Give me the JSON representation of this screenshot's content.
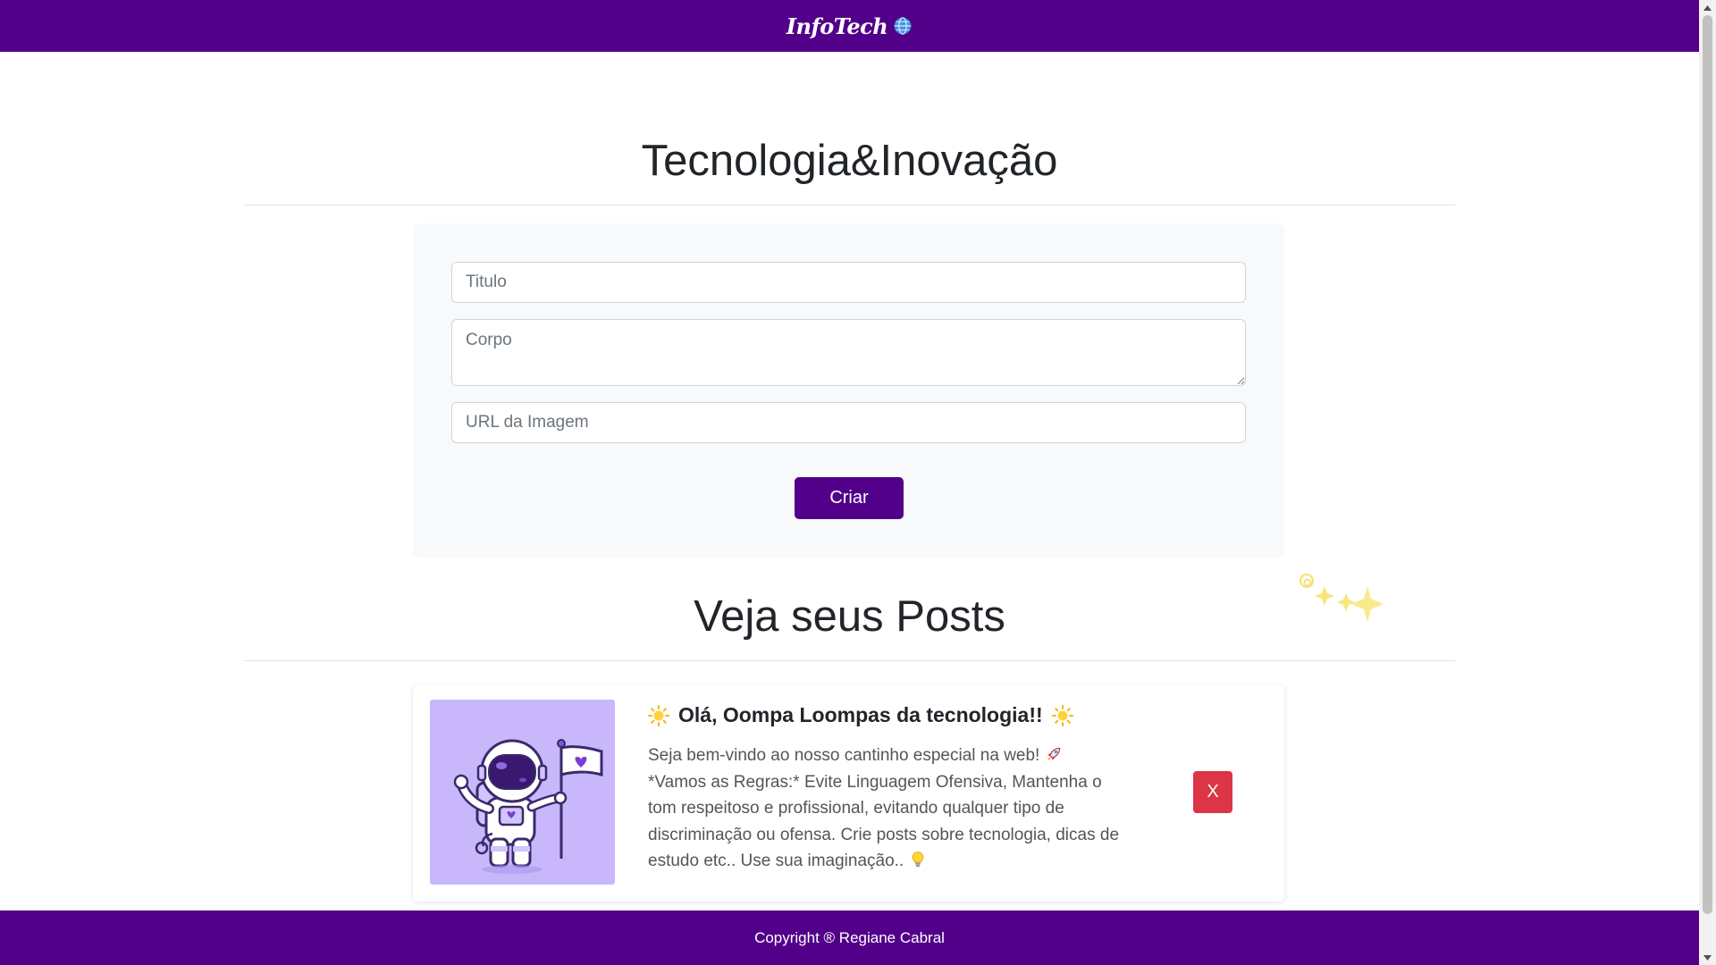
{
  "header": {
    "brand": "InfoTech",
    "brand_icon": "globe-icon"
  },
  "form_section": {
    "title": "Tecnologia&Inovação",
    "title_placeholder": "Titulo",
    "body_placeholder": "Corpo",
    "image_url_placeholder": "URL da Imagem",
    "create_label": "Criar"
  },
  "posts_section": {
    "title": "Veja seus Posts",
    "decoration": "sparkles-icon",
    "posts": [
      {
        "title": "Olá, Oompa Loompas da tecnologia!!",
        "title_icon": "sun-emoji",
        "body_line1": "Seja bem-vindo ao nosso cantinho especial na web!",
        "body_line1_icon": "rocket-emoji",
        "body_line2": "*Vamos as Regras:* Evite Linguagem Ofensiva, Mantenha o tom respeitoso e profissional, evitando qualquer tipo de discriminação ou ofensa. Crie posts sobre tecnologia, dicas de estudo etc.. Use sua imaginação..",
        "body_line2_icon": "lightbulb-emoji",
        "image_icon": "astronaut-flag-illustration",
        "delete_label": "X"
      }
    ]
  },
  "footer": {
    "text": "Copyright ® Regiane Cabral"
  },
  "colors": {
    "primary": "#520089",
    "danger": "#dc3545",
    "card_bg": "#f8f9fa",
    "image_bg": "#c8b8fb"
  }
}
